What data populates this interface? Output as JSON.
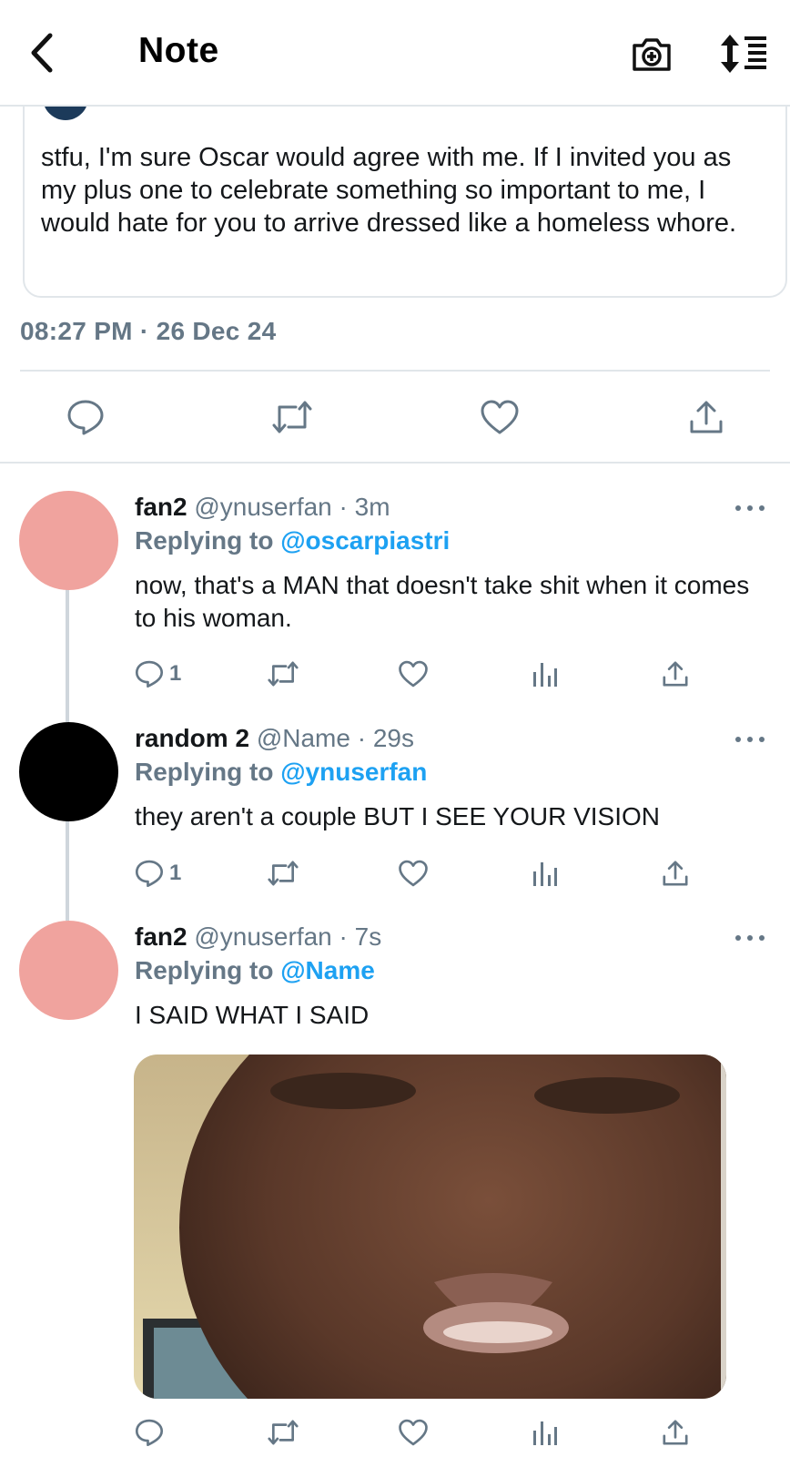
{
  "header": {
    "title": "Note",
    "back_icon": "chevron-left-icon",
    "camera_icon": "camera-add-icon",
    "sort_icon": "sort-list-icon"
  },
  "quote": {
    "text": "stfu, I'm sure Oscar would agree with me. If I invited you as my plus one to celebrate something so important to me, I would hate for you to arrive dressed like a homeless whore."
  },
  "timestamp": "08:27 PM · 26 Dec 24",
  "replies": [
    {
      "name": "fan2",
      "handle": "@ynuserfan",
      "time": "· 3m",
      "replying_label": "Replying to",
      "replying_to": "@oscarpiastri",
      "text": "now, that's a MAN that doesn't take shit when it comes to his woman.",
      "reply_count": "1",
      "avatar_color": "#f0a39e"
    },
    {
      "name": "random 2",
      "handle": "@Name",
      "time": "· 29s",
      "replying_label": "Replying to",
      "replying_to": "@ynuserfan",
      "text": "they aren't a couple BUT I SEE YOUR VISION",
      "reply_count": "1",
      "avatar_color": "#000000"
    },
    {
      "name": "fan2",
      "handle": "@ynuserfan",
      "time": "· 7s",
      "replying_label": "Replying to",
      "replying_to": "@Name",
      "text": "I SAID WHAT I SAID",
      "reply_count": "",
      "avatar_color": "#f0a39e"
    }
  ],
  "colors": {
    "accent": "#1da1f2",
    "muted": "#657786",
    "divider": "#e1e6ea"
  }
}
